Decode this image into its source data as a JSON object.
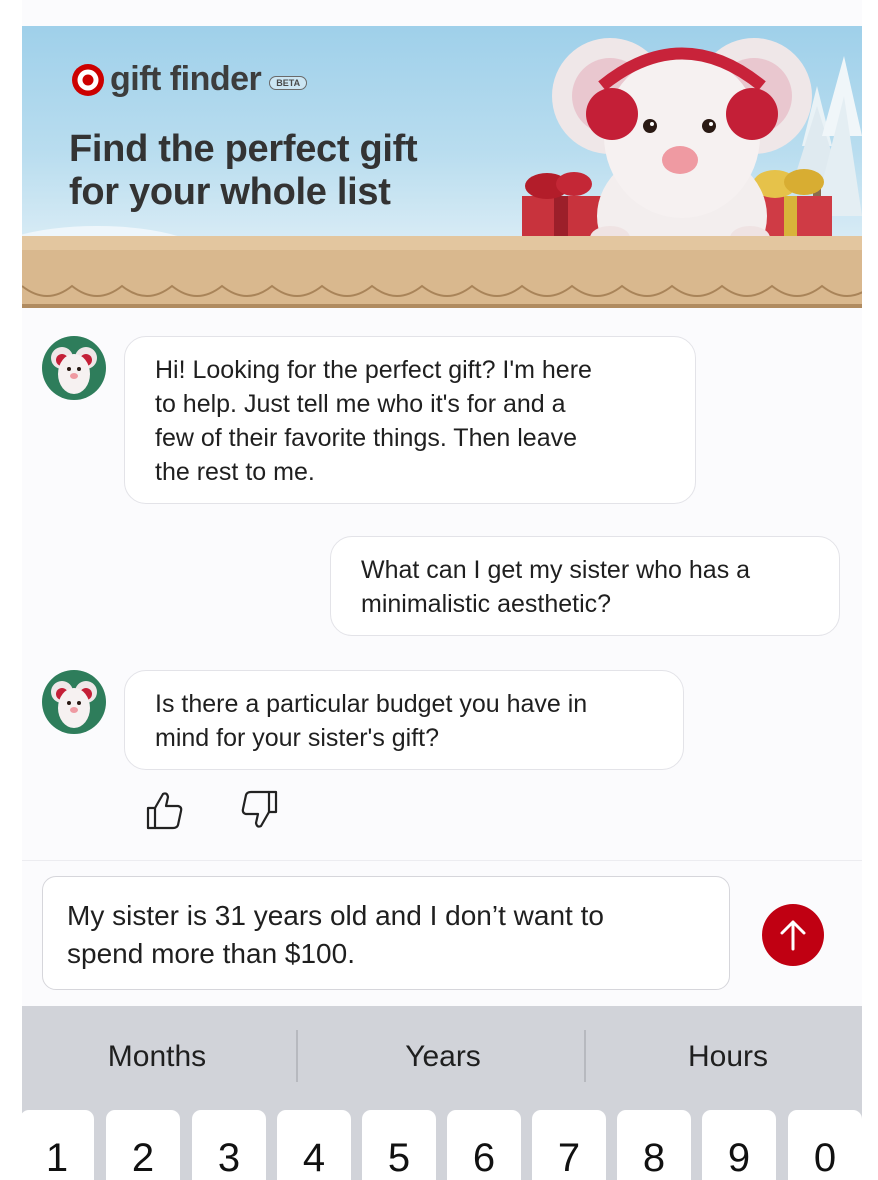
{
  "banner": {
    "brand_name": "gift finder",
    "badge": "BETA",
    "headline_line1": "Find the perfect gift",
    "headline_line2": "for your whole list",
    "icons": [
      "target-logo-icon",
      "mouse-mascot-illustration",
      "gift-box-illustration"
    ]
  },
  "messages": [
    {
      "role": "bot",
      "text": [
        "Hi! Looking for the perfect gift? I'm here",
        "to help. Just tell me who it's for and a",
        "few of their favorite things. Then leave",
        "the rest to me."
      ]
    },
    {
      "role": "user",
      "text": [
        "What can I get my sister who has a",
        "minimalistic aesthetic?"
      ]
    },
    {
      "role": "bot",
      "text": [
        "Is there a particular budget you have in",
        "mind for your sister's gift?"
      ]
    }
  ],
  "feedback": {
    "icons": [
      "thumbs-up-icon",
      "thumbs-down-icon"
    ]
  },
  "composer": {
    "line1": "My sister is 31 years old and I don’t want to",
    "line2": "spend more than $100.",
    "send_icon": "arrow-up-icon"
  },
  "keyboard": {
    "suggestions": [
      "Months",
      "Years",
      "Hours"
    ],
    "keys": [
      "1",
      "2",
      "3",
      "4",
      "5",
      "6",
      "7",
      "8",
      "9",
      "0"
    ]
  },
  "colors": {
    "accent": "#c00012",
    "avatar_bg": "#2e7d5b",
    "keyboard_bg": "#d1d3d9",
    "banner_sky": "#b9ddef",
    "fence": "#d9b88e"
  }
}
